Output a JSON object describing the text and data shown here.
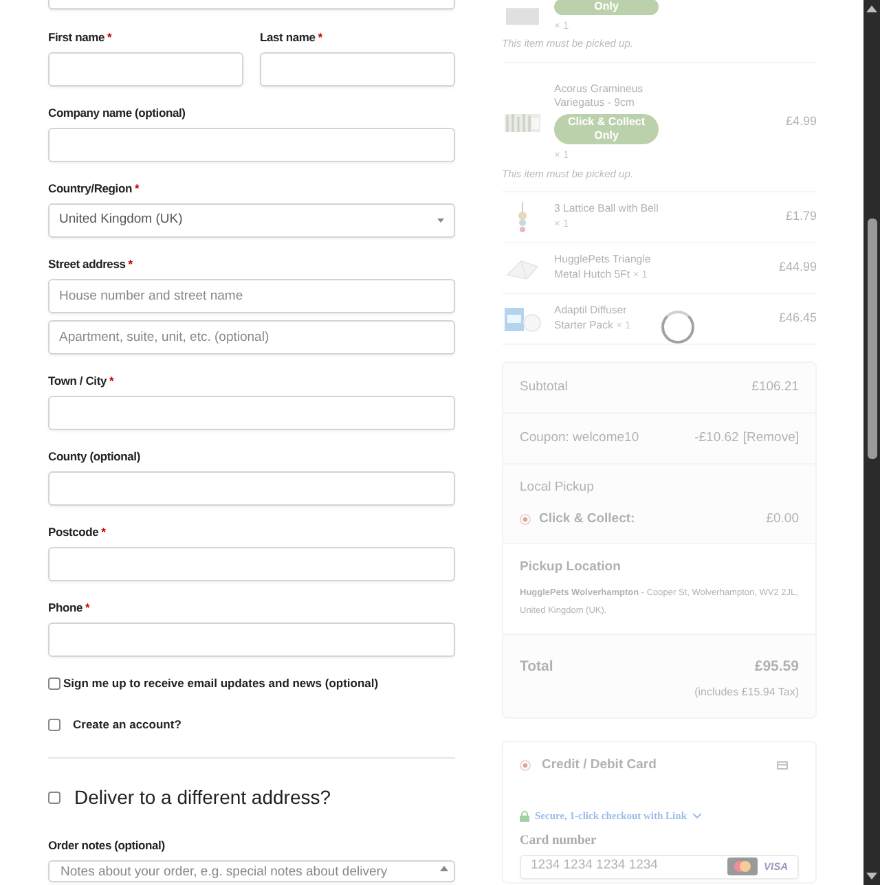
{
  "required_mark": "*",
  "name_fields": [
    {
      "label": "First name",
      "required": true
    },
    {
      "label": "Last name",
      "required": true
    }
  ],
  "fields": [
    {
      "label": "Company name (optional)",
      "required": false,
      "kind": "text"
    },
    {
      "label": "Country/Region",
      "required": true,
      "kind": "select",
      "value": "United Kingdom (UK)"
    },
    {
      "label": "Street address",
      "required": true,
      "kind": "text",
      "placeholders": [
        "House number and street name",
        "Apartment, suite, unit, etc. (optional)"
      ]
    },
    {
      "label": "Town / City",
      "required": true,
      "kind": "text"
    },
    {
      "label": "County (optional)",
      "required": false,
      "kind": "text"
    },
    {
      "label": "Postcode",
      "required": true,
      "kind": "text"
    },
    {
      "label": "Phone",
      "required": true,
      "kind": "text"
    }
  ],
  "checkboxes": [
    {
      "label": "Sign me up to receive email updates and news (optional)",
      "checked": false,
      "kind": "tight"
    },
    {
      "label": "Create an account?",
      "checked": false,
      "kind": "spaced"
    }
  ],
  "ship_toggle": {
    "label": "Deliver to a different address?",
    "checked": false
  },
  "order_notes": {
    "label": "Order notes (optional)",
    "placeholder": "Notes about your order, e.g. special notes about delivery"
  },
  "blocked": true,
  "items": [
    {
      "badge": "Only",
      "qty": "× 1",
      "note": "This item must be picked up.",
      "cut": true
    },
    {
      "name": "Acorus Gramineus Variegatus - 9cm",
      "badge": "Click & Collect Only",
      "qty": "× 1",
      "note": "This item must be picked up.",
      "price": "£4.99"
    },
    {
      "name": "3 Lattice Ball with Bell",
      "qty": "× 1",
      "price": "£1.79"
    },
    {
      "name": "HugglePets Triangle Metal Hutch 5Ft",
      "qty": "× 1",
      "price": "£44.99"
    },
    {
      "name": "Adaptil Diffuser Starter Pack",
      "qty": "× 1",
      "price": "£46.45",
      "loading": true
    }
  ],
  "totals": {
    "subtotal": {
      "label": "Subtotal",
      "value": "£106.21"
    },
    "coupon": {
      "label": "Coupon: welcome10",
      "value": "-£10.62",
      "action": "[Remove]"
    },
    "shipping": {
      "title": "Local Pickup",
      "option": "Click & Collect:",
      "price": "£0.00",
      "selected": true
    },
    "pickup": {
      "title": "Pickup Location",
      "address": "**HugglePets Wolverhampton** - Cooper St, Wolverhampton, WV2 2JL, United Kingdom (UK)."
    },
    "total": {
      "label": "Total",
      "value": "£95.59",
      "note": "(includes £15.94 Tax)"
    }
  },
  "payment": {
    "method": "Credit / Debit Card",
    "selected": true,
    "link": "Secure, 1-click checkout with Link",
    "card_label": "Card number",
    "card_placeholder": "1234 1234 1234 1234",
    "brand": "VISA"
  }
}
